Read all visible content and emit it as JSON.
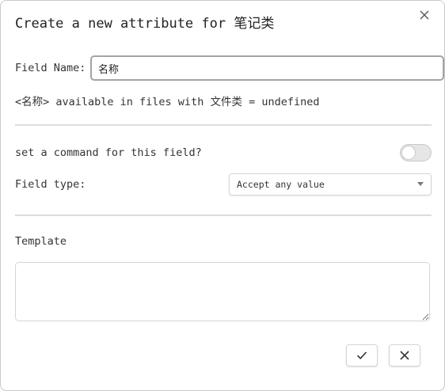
{
  "dialog": {
    "title": "Create a new attribute for 笔记类",
    "close_icon": "close-icon"
  },
  "field_name": {
    "label": "Field Name:",
    "value": "名称"
  },
  "info": {
    "text": "<名称> available in files with 文件类 = undefined"
  },
  "command": {
    "label": "set a command for this field?",
    "toggle_on": false
  },
  "field_type": {
    "label": "Field type:",
    "selected": "Accept any value"
  },
  "template": {
    "label": "Template",
    "value": ""
  },
  "buttons": {
    "confirm_icon": "check-icon",
    "cancel_icon": "close-icon"
  },
  "colors": {
    "border": "#c9c9c9",
    "input_focus_border": "#a3a3a3",
    "divider": "#dcdcdc",
    "toggle_off": "#e6e6e6"
  }
}
